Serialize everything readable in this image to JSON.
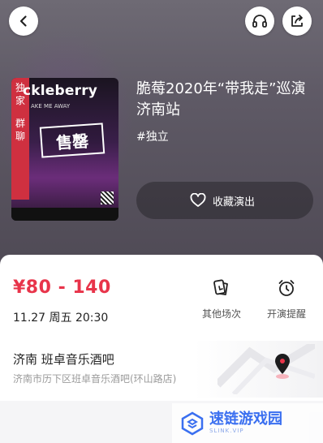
{
  "header": {
    "back_icon": "chevron-left-icon",
    "headset_icon": "headset-icon",
    "share_icon": "share-icon"
  },
  "poster": {
    "band_name": "ckleberry",
    "tour_sub": "AKE ME AWAY",
    "badge_exclusive": "独家",
    "badge_group": "群聊",
    "stamp_text": "售罄"
  },
  "event": {
    "title": "脆莓2020年“带我走”巡演 济南站",
    "tag": "#独立",
    "favorite_label": "收藏演出"
  },
  "ticket": {
    "price": "¥80 - 140",
    "datetime": "11.27 周五 20:30",
    "other_sessions_label": "其他场次",
    "reminder_label": "开演提醒"
  },
  "venue": {
    "name": "济南 班卓音乐酒吧",
    "address": "济南市历下区班卓音乐酒吧(环山路店)"
  },
  "watermark": {
    "text": "速链游戏园",
    "sub": "SLINK.VIP"
  },
  "colors": {
    "price_red": "#e8344a",
    "hero_bg": "#5f5a66"
  }
}
